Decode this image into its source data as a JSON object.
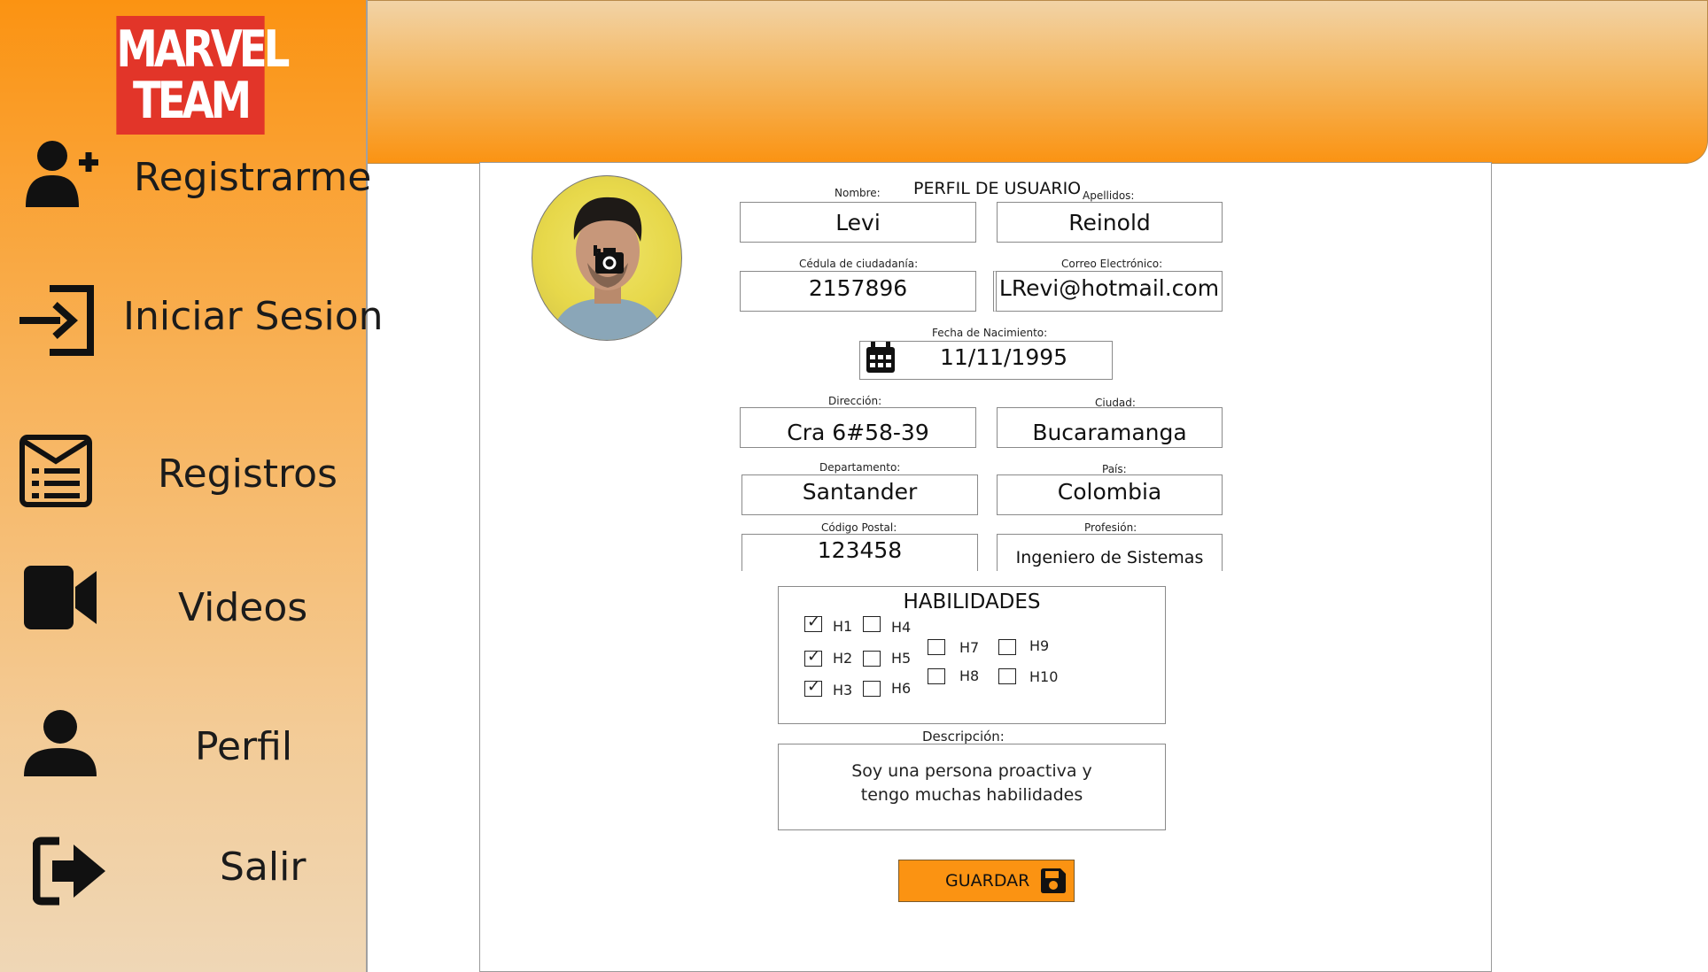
{
  "sidebar": {
    "logo_line1": "MARVEL",
    "logo_line2": "TEAM",
    "items": [
      {
        "label": "Registrarme",
        "icon": "add-user-icon"
      },
      {
        "label": "Iniciar Sesion",
        "icon": "sign-in-icon"
      },
      {
        "label": "Registros",
        "icon": "list-envelope-icon"
      },
      {
        "label": "Videos",
        "icon": "video-camera-icon"
      },
      {
        "label": "Perfil",
        "icon": "user-icon"
      },
      {
        "label": "Salir",
        "icon": "sign-out-icon"
      }
    ]
  },
  "form": {
    "title": "PERFIL DE USUARIO",
    "nombre_label": "Nombre:",
    "nombre": "Levi",
    "apellidos_label": "Apellidos:",
    "apellidos": "Reinold",
    "cedula_label": "Cédula de ciudadanía:",
    "cedula": "2157896",
    "correo_label": "Correo Electrónico:",
    "correo": "LRevi@hotmail.com",
    "fecha_label": "Fecha de Nacimiento:",
    "fecha": "11/11/1995",
    "direccion_label": "Dirección:",
    "direccion": "Cra 6#58-39",
    "ciudad_label": "Ciudad:",
    "ciudad": "Bucaramanga",
    "departamento_label": "Departamento:",
    "departamento": "Santander",
    "pais_label": "País:",
    "pais": "Colombia",
    "postal_label": "Código Postal:",
    "postal": "123458",
    "profesion_label": "Profesión:",
    "profesion": "Ingeniero de Sistemas",
    "habilidades_title": "HABILIDADES",
    "habilidades": [
      {
        "label": "H1",
        "checked": true
      },
      {
        "label": "H2",
        "checked": true
      },
      {
        "label": "H3",
        "checked": true
      },
      {
        "label": "H4",
        "checked": false
      },
      {
        "label": "H5",
        "checked": false
      },
      {
        "label": "H6",
        "checked": false
      },
      {
        "label": "H7",
        "checked": false
      },
      {
        "label": "H8",
        "checked": false
      },
      {
        "label": "H9",
        "checked": false
      },
      {
        "label": "H10",
        "checked": false
      }
    ],
    "descripcion_label": "Descripción:",
    "descripcion_line1": "Soy una persona proactiva y",
    "descripcion_line2": "tengo muchas habilidades",
    "save_label": "GUARDAR"
  },
  "colors": {
    "accent": "#fb9312",
    "logo_red": "#e23529"
  }
}
